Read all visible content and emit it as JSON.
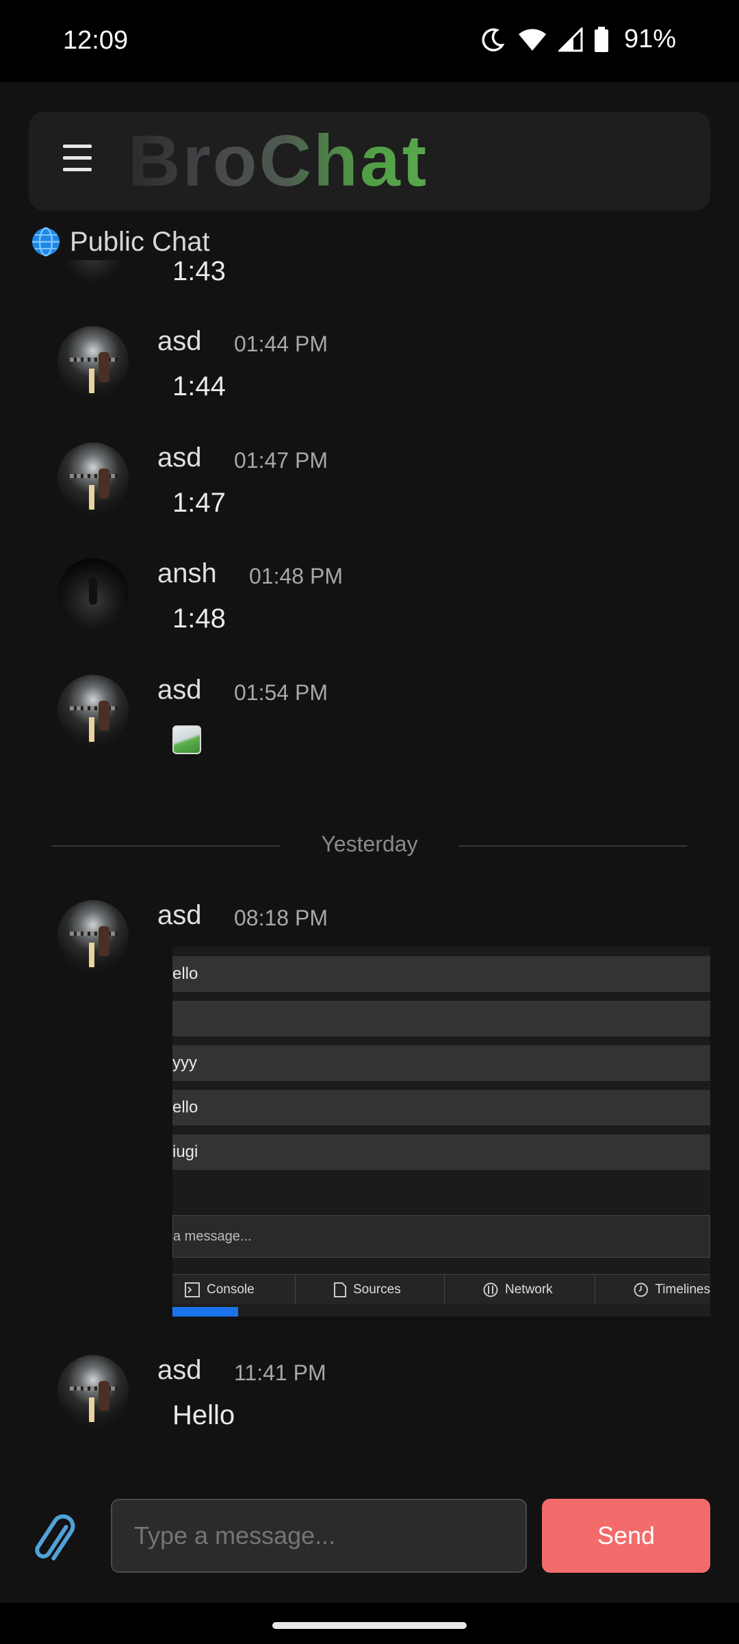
{
  "status_bar": {
    "time": "12:09",
    "battery": "91%"
  },
  "header": {
    "brand": "BroChat"
  },
  "section": {
    "label": "Public Chat"
  },
  "messages": [
    {
      "user": "",
      "time": "",
      "text": "1:43"
    },
    {
      "user": "asd",
      "time": "01:44 PM",
      "text": "1:44"
    },
    {
      "user": "asd",
      "time": "01:47 PM",
      "text": "1:47"
    },
    {
      "user": "ansh",
      "time": "01:48 PM",
      "text": "1:48"
    },
    {
      "user": "asd",
      "time": "01:54 PM",
      "text": ""
    },
    {
      "user": "asd",
      "time": "08:18 PM",
      "text": ""
    },
    {
      "user": "asd",
      "time": "11:41 PM",
      "text": "Hello"
    }
  ],
  "divider": {
    "label": "Yesterday"
  },
  "screenshot": {
    "rows": [
      "ello",
      "",
      "yyy",
      "ello",
      "iugi"
    ],
    "input_placeholder": "a message...",
    "tabs": [
      "Console",
      "Sources",
      "Network",
      "Timelines"
    ]
  },
  "composer": {
    "placeholder": "Type a message...",
    "send_label": "Send"
  },
  "colors": {
    "background": "#121212",
    "accent_send": "#f36b6b",
    "brand_green": "#5aa84e"
  }
}
